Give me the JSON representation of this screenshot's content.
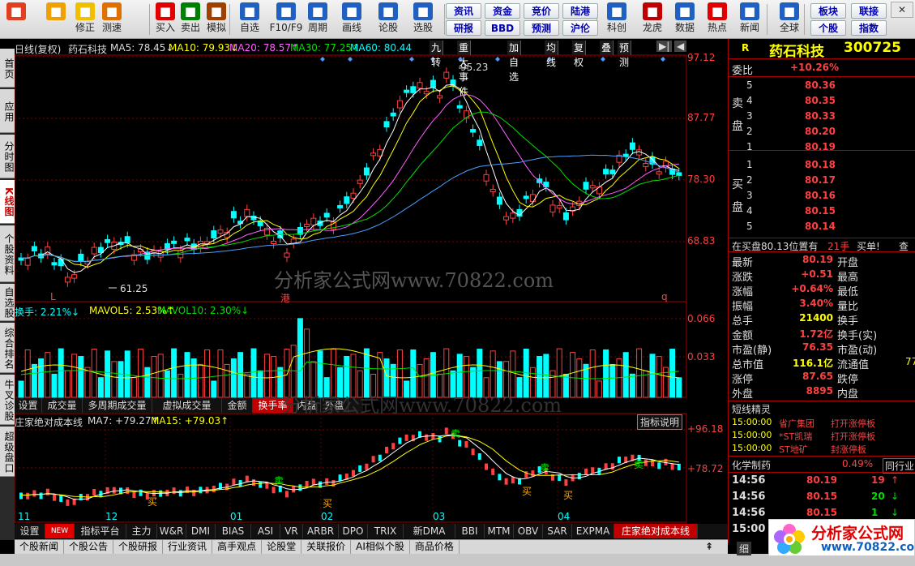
{
  "toolbar": {
    "buttons": [
      {
        "label": "",
        "icon": "grid-icon",
        "color": "#e04020"
      },
      {
        "label": "",
        "icon": "back-arrow-icon",
        "color": "#f0a000"
      },
      {
        "label": "修正",
        "icon": "repair-icon",
        "color": "#f0c000"
      },
      {
        "label": "测速",
        "icon": "clock-icon",
        "color": "#e07000"
      },
      {
        "label": "买入",
        "icon": "buy-icon",
        "color": "#e00000"
      },
      {
        "label": "卖出",
        "icon": "sell-icon",
        "color": "#008000"
      },
      {
        "label": "模拟",
        "icon": "hammer-icon",
        "color": "#a04000"
      },
      {
        "label": "自选",
        "icon": "briefcase-icon",
        "color": "#2060c0"
      },
      {
        "label": "F10/F9",
        "icon": "document-icon",
        "color": "#2060c0"
      },
      {
        "label": "周期",
        "icon": "cycle-icon",
        "color": "#2060c0"
      },
      {
        "label": "画线",
        "icon": "pencil-icon",
        "color": "#2060c0"
      },
      {
        "label": "论股",
        "icon": "discuss-icon",
        "color": "#2060c0"
      },
      {
        "label": "选股",
        "icon": "search-stock-icon",
        "color": "#2060c0"
      },
      {
        "label": "科创",
        "icon": "chart-board-icon",
        "color": "#2060c0"
      },
      {
        "label": "龙虎",
        "icon": "dragon-icon",
        "color": "#c00000"
      },
      {
        "label": "数据",
        "icon": "pe-icon",
        "color": "#2060c0"
      },
      {
        "label": "热点",
        "icon": "hot-icon",
        "color": "#e00000"
      },
      {
        "label": "新闻",
        "icon": "news-icon",
        "color": "#2060c0"
      },
      {
        "label": "全球",
        "icon": "globe-icon",
        "color": "#2060c0"
      }
    ],
    "small_buttons": [
      "资讯",
      "资金",
      "竞价",
      "陆港",
      "研报",
      "BBD",
      "预测",
      "沪伦",
      "板块",
      "联接",
      "个股",
      "指数"
    ],
    "close": "✕"
  },
  "side_tabs": [
    "首页",
    "应用",
    "分时图",
    "K线图",
    "个股资料",
    "自选股",
    "综合排名",
    "牛叉诊股",
    "超级盘口"
  ],
  "price_chart": {
    "legend": {
      "title": "日线(复权)",
      "name": "药石科技",
      "ma5": "MA5: 78.45↓",
      "ma10": "MA10: 79.93↓",
      "ma20": "MA20: 78.57↑",
      "ma30": "MA30: 77.25↑",
      "ma60": "MA60: 80.44"
    },
    "tools": [
      "九转",
      "重大事件",
      "加自选",
      "均线",
      "复权",
      "叠",
      "预测"
    ],
    "yticks": [
      "97.12",
      "87.77",
      "78.30",
      "68.83"
    ],
    "high": "95.23",
    "low": "61.25",
    "markers": [
      "L",
      "港",
      "q"
    ],
    "watermark": "分析家公式网www.70822.com"
  },
  "volume_chart": {
    "legend": {
      "a": "换手: 2.21%↓",
      "b": "MAVOL5: 2.53%↑",
      "c": "MAVOL10: 2.30%↓"
    },
    "yticks": [
      "0.066",
      "0.033"
    ],
    "tabs": [
      "设置",
      "成交量",
      "多周期成交量",
      "虚拟成交量",
      "金额",
      "换手率",
      "内盘",
      "外盘"
    ],
    "active": "换手率"
  },
  "indicator_chart": {
    "legend": {
      "name": "庄家绝对成本线",
      "ma7": "MA7: +79.27↑",
      "ma15": "MA15: +79.03↑"
    },
    "help": "指标说明",
    "yticks": [
      "+96.18",
      "+78.72"
    ],
    "signals": [
      "买",
      "买",
      "买",
      "卖",
      "卖",
      "卖",
      "卖"
    ],
    "xticks": [
      "11",
      "12",
      "01",
      "02",
      "03",
      "04"
    ]
  },
  "indicator_tabs": [
    "设置",
    "NEW",
    "指标平台",
    "主力",
    "W&R",
    "DMI",
    "BIAS",
    "ASI",
    "VR",
    "ARBR",
    "DPO",
    "TRIX",
    "新DMA",
    "BBI",
    "MTM",
    "OBV",
    "SAR",
    "EXPMA",
    "庄家绝对成本线"
  ],
  "bottom_tabs": [
    "个股新闻",
    "个股公告",
    "个股研报",
    "行业资讯",
    "高手观点",
    "论股堂",
    "关联报价",
    "AI相似个股",
    "商品价格"
  ],
  "quote": {
    "name": "药石科技",
    "code": "300725",
    "r_label": "R",
    "weibi_label": "委比",
    "weibi": "+10.26%",
    "sell_label": "卖盘",
    "buy_label": "买盘",
    "asks": [
      {
        "lv": "5",
        "p": "80.36",
        "v": ""
      },
      {
        "lv": "4",
        "p": "80.35",
        "v": ""
      },
      {
        "lv": "3",
        "p": "80.33",
        "v": ""
      },
      {
        "lv": "2",
        "p": "80.20",
        "v": ""
      },
      {
        "lv": "1",
        "p": "80.19",
        "v": ""
      }
    ],
    "bids": [
      {
        "lv": "1",
        "p": "80.18",
        "v": ""
      },
      {
        "lv": "2",
        "p": "80.17",
        "v": ""
      },
      {
        "lv": "3",
        "p": "80.16",
        "v": ""
      },
      {
        "lv": "4",
        "p": "80.15",
        "v": ""
      },
      {
        "lv": "5",
        "p": "80.14",
        "v": ""
      }
    ],
    "buyline": "在买盘80.13位置有",
    "buyline_v": "21手",
    "buyline_t": "买单!",
    "buyline_q": "查",
    "stats": [
      {
        "k": "最新",
        "v": "80.19",
        "k2": "开盘",
        "v2": ""
      },
      {
        "k": "涨跌",
        "v": "+0.51",
        "k2": "最高",
        "v2": ""
      },
      {
        "k": "涨幅",
        "v": "+0.64%",
        "k2": "最低",
        "v2": ""
      },
      {
        "k": "振幅",
        "v": "3.40%",
        "k2": "量比",
        "v2": ""
      },
      {
        "k": "总手",
        "v": "21400",
        "k2": "换手",
        "v2": ""
      },
      {
        "k": "金额",
        "v": "1.72亿",
        "k2": "换手(实)",
        "v2": ""
      },
      {
        "k": "市盈(静)",
        "v": "76.35",
        "k2": "市盈(动)",
        "v2": ""
      },
      {
        "k": "总市值",
        "v": "116.1亿",
        "k2": "流通值",
        "v2": "77"
      },
      {
        "k": "涨停",
        "v": "87.65",
        "k2": "跌停",
        "v2": ""
      },
      {
        "k": "外盘",
        "v": "8895",
        "k2": "内盘",
        "v2": ""
      }
    ],
    "jingling_title": "短线精灵",
    "jingling": [
      {
        "t": "15:00:00",
        "n": "省广集团",
        "e": "打开涨停板"
      },
      {
        "t": "15:00:00",
        "n": "*ST凯瑞",
        "e": "打开涨停板"
      },
      {
        "t": "15:00:00",
        "n": "ST地矿",
        "e": "封涨停板"
      }
    ],
    "sector": "化学制药",
    "sector_pct": "0.49%",
    "sector_btn": "同行业",
    "ticks": [
      {
        "t": "14:56",
        "p": "80.19",
        "v": "19",
        "d": "up"
      },
      {
        "t": "14:56",
        "p": "80.15",
        "v": "20",
        "d": "down"
      },
      {
        "t": "14:56",
        "p": "80.15",
        "v": "1",
        "d": "down"
      },
      {
        "t": "15:00",
        "p": "",
        "v": "",
        "d": ""
      }
    ],
    "detail_btn": "细"
  },
  "logo": {
    "text": "分析家公式网",
    "url": "www.70822.com"
  }
}
